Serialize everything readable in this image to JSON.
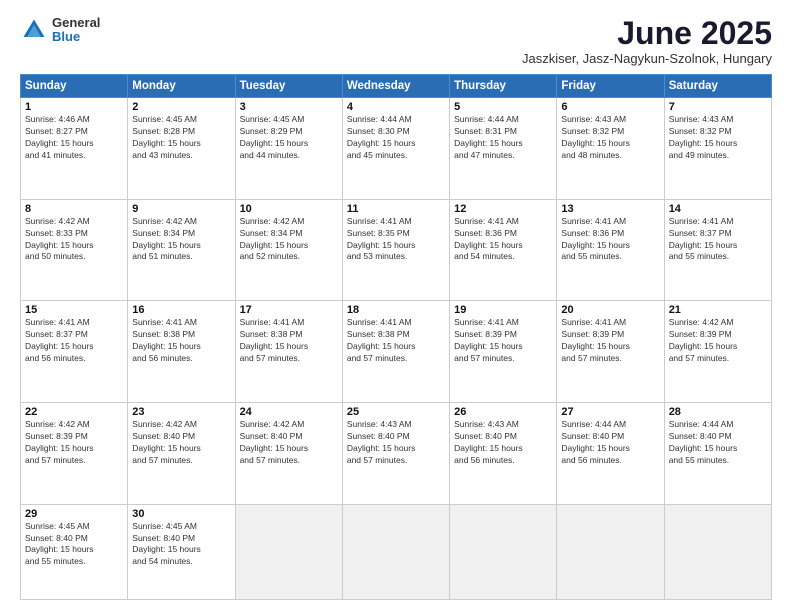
{
  "header": {
    "logo_general": "General",
    "logo_blue": "Blue",
    "month_title": "June 2025",
    "subtitle": "Jaszkiser, Jasz-Nagykun-Szolnok, Hungary"
  },
  "days_of_week": [
    "Sunday",
    "Monday",
    "Tuesday",
    "Wednesday",
    "Thursday",
    "Friday",
    "Saturday"
  ],
  "weeks": [
    [
      {
        "num": "1",
        "info": "Sunrise: 4:46 AM\nSunset: 8:27 PM\nDaylight: 15 hours\nand 41 minutes."
      },
      {
        "num": "2",
        "info": "Sunrise: 4:45 AM\nSunset: 8:28 PM\nDaylight: 15 hours\nand 43 minutes."
      },
      {
        "num": "3",
        "info": "Sunrise: 4:45 AM\nSunset: 8:29 PM\nDaylight: 15 hours\nand 44 minutes."
      },
      {
        "num": "4",
        "info": "Sunrise: 4:44 AM\nSunset: 8:30 PM\nDaylight: 15 hours\nand 45 minutes."
      },
      {
        "num": "5",
        "info": "Sunrise: 4:44 AM\nSunset: 8:31 PM\nDaylight: 15 hours\nand 47 minutes."
      },
      {
        "num": "6",
        "info": "Sunrise: 4:43 AM\nSunset: 8:32 PM\nDaylight: 15 hours\nand 48 minutes."
      },
      {
        "num": "7",
        "info": "Sunrise: 4:43 AM\nSunset: 8:32 PM\nDaylight: 15 hours\nand 49 minutes."
      }
    ],
    [
      {
        "num": "8",
        "info": "Sunrise: 4:42 AM\nSunset: 8:33 PM\nDaylight: 15 hours\nand 50 minutes."
      },
      {
        "num": "9",
        "info": "Sunrise: 4:42 AM\nSunset: 8:34 PM\nDaylight: 15 hours\nand 51 minutes."
      },
      {
        "num": "10",
        "info": "Sunrise: 4:42 AM\nSunset: 8:34 PM\nDaylight: 15 hours\nand 52 minutes."
      },
      {
        "num": "11",
        "info": "Sunrise: 4:41 AM\nSunset: 8:35 PM\nDaylight: 15 hours\nand 53 minutes."
      },
      {
        "num": "12",
        "info": "Sunrise: 4:41 AM\nSunset: 8:36 PM\nDaylight: 15 hours\nand 54 minutes."
      },
      {
        "num": "13",
        "info": "Sunrise: 4:41 AM\nSunset: 8:36 PM\nDaylight: 15 hours\nand 55 minutes."
      },
      {
        "num": "14",
        "info": "Sunrise: 4:41 AM\nSunset: 8:37 PM\nDaylight: 15 hours\nand 55 minutes."
      }
    ],
    [
      {
        "num": "15",
        "info": "Sunrise: 4:41 AM\nSunset: 8:37 PM\nDaylight: 15 hours\nand 56 minutes."
      },
      {
        "num": "16",
        "info": "Sunrise: 4:41 AM\nSunset: 8:38 PM\nDaylight: 15 hours\nand 56 minutes."
      },
      {
        "num": "17",
        "info": "Sunrise: 4:41 AM\nSunset: 8:38 PM\nDaylight: 15 hours\nand 57 minutes."
      },
      {
        "num": "18",
        "info": "Sunrise: 4:41 AM\nSunset: 8:38 PM\nDaylight: 15 hours\nand 57 minutes."
      },
      {
        "num": "19",
        "info": "Sunrise: 4:41 AM\nSunset: 8:39 PM\nDaylight: 15 hours\nand 57 minutes."
      },
      {
        "num": "20",
        "info": "Sunrise: 4:41 AM\nSunset: 8:39 PM\nDaylight: 15 hours\nand 57 minutes."
      },
      {
        "num": "21",
        "info": "Sunrise: 4:42 AM\nSunset: 8:39 PM\nDaylight: 15 hours\nand 57 minutes."
      }
    ],
    [
      {
        "num": "22",
        "info": "Sunrise: 4:42 AM\nSunset: 8:39 PM\nDaylight: 15 hours\nand 57 minutes."
      },
      {
        "num": "23",
        "info": "Sunrise: 4:42 AM\nSunset: 8:40 PM\nDaylight: 15 hours\nand 57 minutes."
      },
      {
        "num": "24",
        "info": "Sunrise: 4:42 AM\nSunset: 8:40 PM\nDaylight: 15 hours\nand 57 minutes."
      },
      {
        "num": "25",
        "info": "Sunrise: 4:43 AM\nSunset: 8:40 PM\nDaylight: 15 hours\nand 57 minutes."
      },
      {
        "num": "26",
        "info": "Sunrise: 4:43 AM\nSunset: 8:40 PM\nDaylight: 15 hours\nand 56 minutes."
      },
      {
        "num": "27",
        "info": "Sunrise: 4:44 AM\nSunset: 8:40 PM\nDaylight: 15 hours\nand 56 minutes."
      },
      {
        "num": "28",
        "info": "Sunrise: 4:44 AM\nSunset: 8:40 PM\nDaylight: 15 hours\nand 55 minutes."
      }
    ],
    [
      {
        "num": "29",
        "info": "Sunrise: 4:45 AM\nSunset: 8:40 PM\nDaylight: 15 hours\nand 55 minutes."
      },
      {
        "num": "30",
        "info": "Sunrise: 4:45 AM\nSunset: 8:40 PM\nDaylight: 15 hours\nand 54 minutes."
      },
      {
        "num": "",
        "info": ""
      },
      {
        "num": "",
        "info": ""
      },
      {
        "num": "",
        "info": ""
      },
      {
        "num": "",
        "info": ""
      },
      {
        "num": "",
        "info": ""
      }
    ]
  ]
}
